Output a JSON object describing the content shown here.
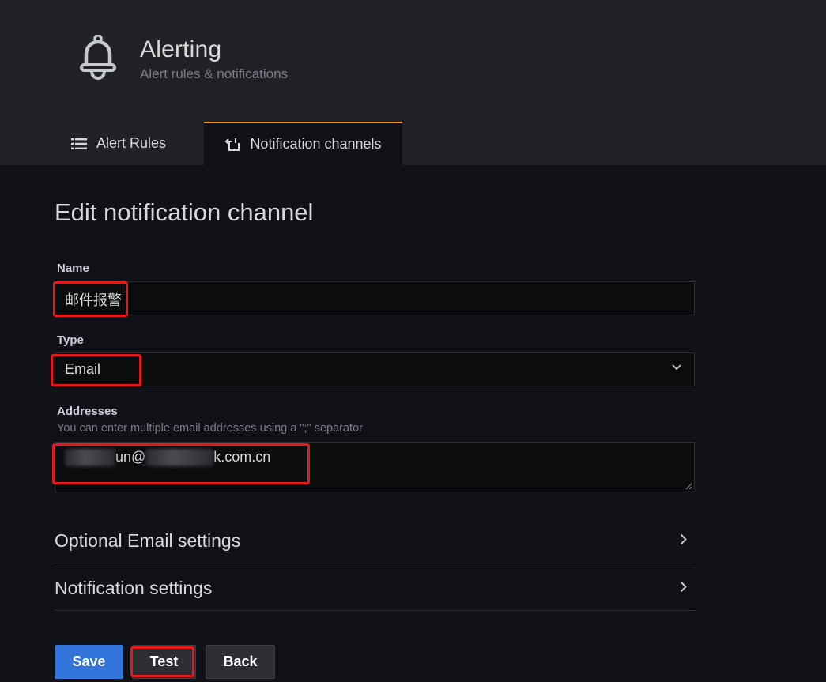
{
  "header": {
    "icon": "bell-icon",
    "title": "Alerting",
    "subtitle": "Alert rules & notifications",
    "tabs": [
      {
        "label": "Alert Rules",
        "icon": "list-icon",
        "active": false
      },
      {
        "label": "Notification channels",
        "icon": "channel-icon",
        "active": true
      }
    ],
    "active_tab_color": "#f79520"
  },
  "form": {
    "heading": "Edit notification channel",
    "name": {
      "label": "Name",
      "value": "邮件报警"
    },
    "type": {
      "label": "Type",
      "value": "Email"
    },
    "addresses": {
      "label": "Addresses",
      "description": "You can enter multiple email addresses using a \";\" separator",
      "visible_fragments": [
        "un@",
        "k.com.cn"
      ]
    }
  },
  "sections": [
    {
      "label": "Optional Email settings"
    },
    {
      "label": "Notification settings"
    }
  ],
  "buttons": {
    "save": "Save",
    "test": "Test",
    "back": "Back"
  },
  "colors": {
    "primary": "#3274d9",
    "highlight_box": "#e5191b"
  }
}
